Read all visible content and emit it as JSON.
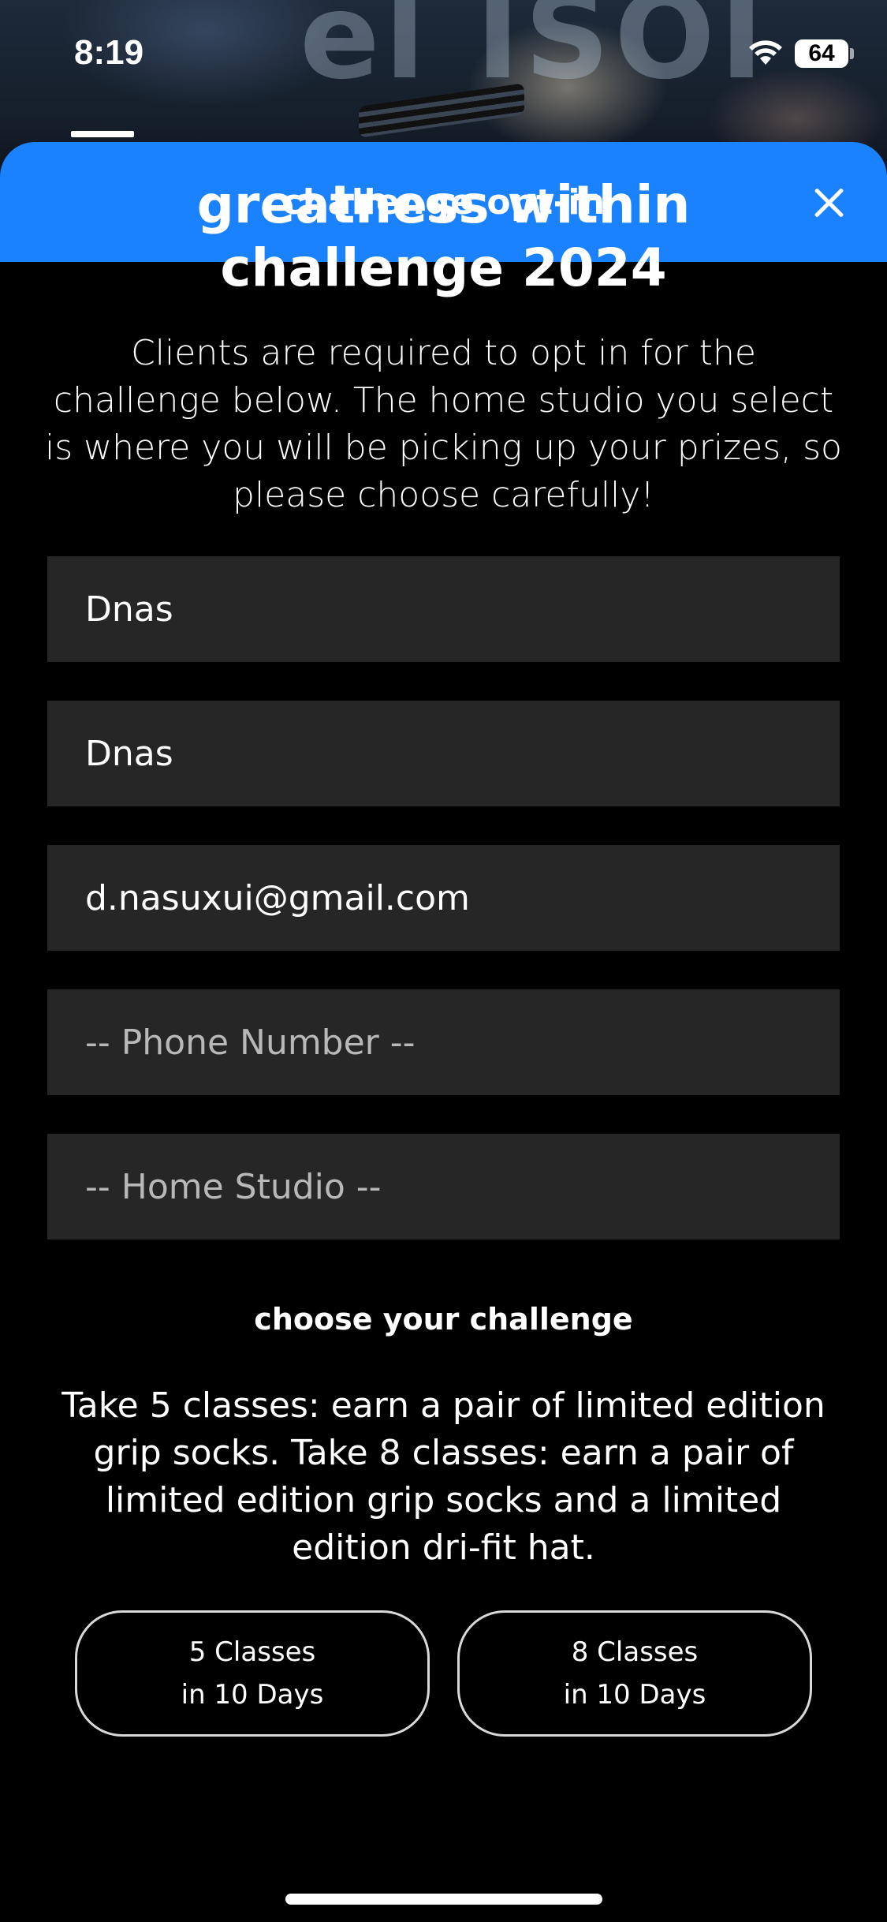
{
  "status_bar": {
    "time": "8:19",
    "battery": "64"
  },
  "sheet": {
    "header_title": "challenge opt-in",
    "title": "greatness within challenge 2024",
    "intro": "Clients are required to opt in for the challenge below. The home studio you select is where you will be picking up your prizes, so please choose carefully!"
  },
  "form": {
    "first_name": {
      "value": "Dnas"
    },
    "last_name": {
      "value": "Dnas"
    },
    "email": {
      "value": "d.nasuxui@gmail.com"
    },
    "phone": {
      "placeholder": "-- Phone Number --"
    },
    "home_studio": {
      "placeholder": "-- Home Studio --"
    }
  },
  "challenge": {
    "label": "choose your challenge",
    "description": "Take 5 classes: earn a pair of limited edition grip socks. Take 8 classes: earn a pair of limited edition grip socks and a limited edition dri-fit hat.",
    "options": [
      {
        "line1": "5 Classes",
        "line2": "in 10 Days"
      },
      {
        "line1": "8 Classes",
        "line2": "in 10 Days"
      }
    ]
  },
  "background": {
    "letters": "el   ISOI"
  },
  "colors": {
    "accent": "#1a82ff",
    "field_bg": "#262626",
    "background": "#000000"
  }
}
